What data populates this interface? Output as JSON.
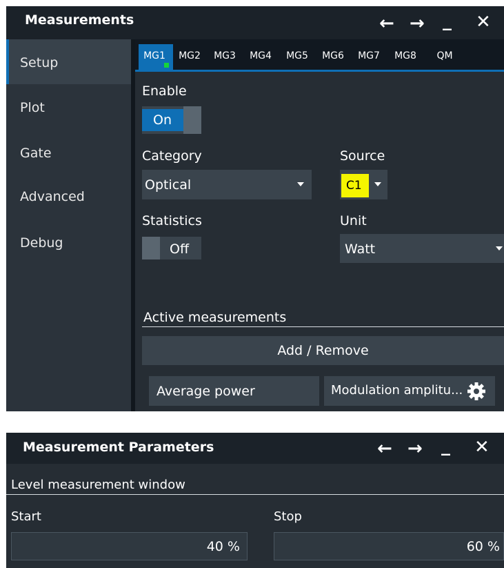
{
  "measurements_window": {
    "title": "Measurements",
    "sidebar": [
      "Setup",
      "Plot",
      "Gate",
      "Advanced",
      "Debug"
    ],
    "tabs": [
      "MG1",
      "MG2",
      "MG3",
      "MG4",
      "MG5",
      "MG6",
      "MG7",
      "MG8",
      "QM"
    ],
    "enable_label": "Enable",
    "enable_state": "On",
    "category_label": "Category",
    "category_value": "Optical",
    "source_label": "Source",
    "source_value": "C1",
    "statistics_label": "Statistics",
    "statistics_state": "Off",
    "unit_label": "Unit",
    "unit_value": "Watt",
    "active_label": "Active measurements",
    "add_remove": "Add / Remove",
    "measurement_1": "Average power",
    "measurement_2": "Modulation amplitu..."
  },
  "params_window": {
    "title": "Measurement Parameters",
    "section_label": "Level measurement window",
    "start_label": "Start",
    "start_value": "40 %",
    "stop_label": "Stop",
    "stop_value": "60 %"
  },
  "colors": {
    "accent_blue": "#0f6fb5",
    "source_yellow": "#f5f500",
    "active_green": "#17d43a"
  }
}
